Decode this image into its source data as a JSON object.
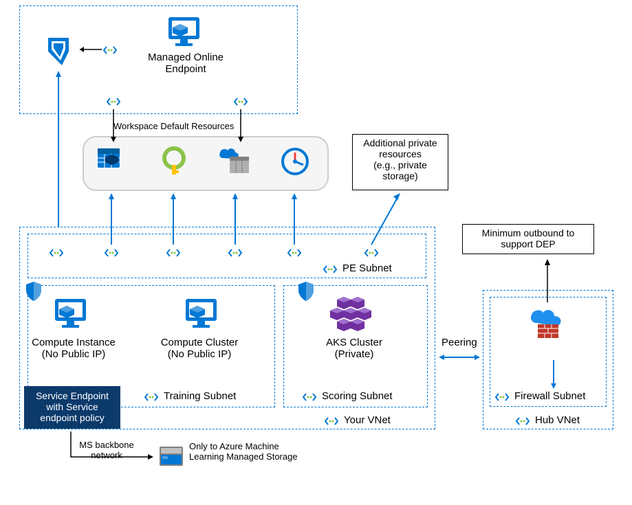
{
  "topBox": {
    "endpoint_label": "Managed Online\nEndpoint"
  },
  "workspace_resources_label": "Workspace Default Resources",
  "additional_resources_label": "Additional private\nresources\n(e.g., private\nstorage)",
  "pe_subnet_label": "PE Subnet",
  "compute_instance_label": "Compute Instance\n(No Public IP)",
  "compute_cluster_label": "Compute Cluster\n(No Public IP)",
  "aks_cluster_label": "AKS Cluster\n(Private)",
  "training_subnet_label": "Training Subnet",
  "scoring_subnet_label": "Scoring Subnet",
  "your_vnet_label": "Your VNet",
  "service_endpoint_label": "Service Endpoint\nwith Service\nendpoint policy",
  "ms_backbone_label": "MS backbone\nnetwork",
  "managed_storage_label": "Only to Azure Machine\nLearning Managed Storage",
  "peering_label": "Peering",
  "minimum_outbound_label": "Minimum outbound to\nsupport DEP",
  "firewall_subnet_label": "Firewall Subnet",
  "hub_vnet_label": "Hub VNet",
  "icon_names": {
    "ml": "azure-ml-icon",
    "vm": "vm-icon",
    "calendar": "storage-icon",
    "key": "keyvault-icon",
    "acr": "container-registry-icon",
    "appinsights": "app-insights-icon",
    "aks": "aks-icon",
    "firewall": "firewall-icon",
    "storage": "storage-icon"
  }
}
